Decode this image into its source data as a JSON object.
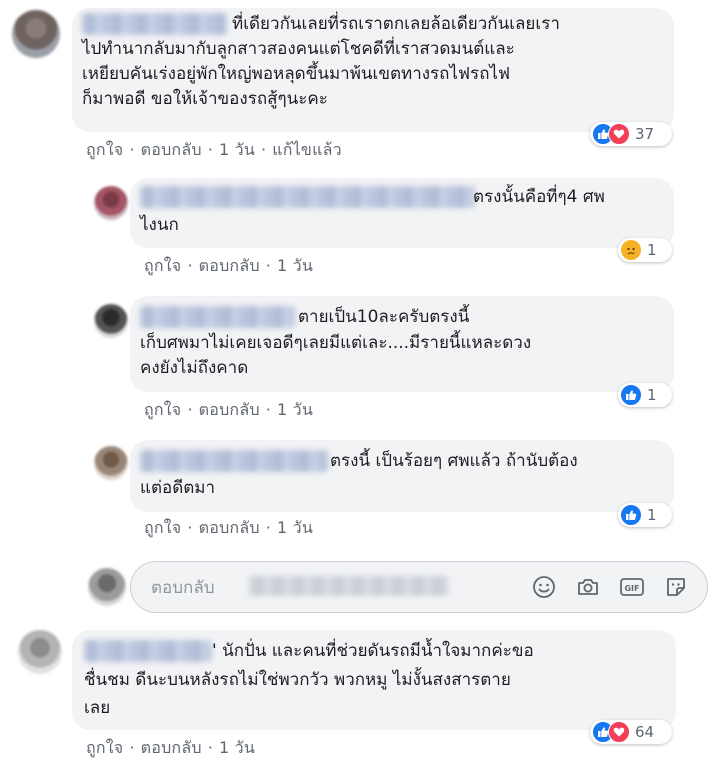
{
  "comments": [
    {
      "lines": [
        "ที่เดียวกันเลยที่รถเราตกเลยล้อเดียวกันเลยเรา",
        "ไปทำนากลับมากับลูกสาวสองคนแต่โชคดีที่เราสวดมนต์และ",
        "เหยียบคันเร่งอยู่พักใหญ่พอหลุดขึ้นมาพ้นเขตทางรถไฟรถไฟ",
        "ก็มาพอดี ขอให้เจ้าของรถสู้ๆนะคะ"
      ],
      "actions": [
        "ถูกใจ",
        "ตอบกลับ",
        "1 วัน",
        "แก้ไขแล้ว"
      ],
      "reaction_count": "37",
      "reaction_icons": [
        "like-icon",
        "love-icon"
      ]
    },
    {
      "lines": [
        "ตรงนั้นคือที่ๆ4 ศพ",
        "ไงนก"
      ],
      "actions": [
        "ถูกใจ",
        "ตอบกลับ",
        "1 วัน"
      ],
      "reaction_count": "1",
      "reaction_icons": [
        "sad-icon"
      ]
    },
    {
      "lines": [
        "ตายเป็น10ละครับตรงนี้",
        "เก็บศพมาไม่เคยเจอดีๆเลยมีแต่เละ....มีรายนี้แหละดวง",
        "คงยังไม่ถึงคาด"
      ],
      "actions": [
        "ถูกใจ",
        "ตอบกลับ",
        "1 วัน"
      ],
      "reaction_count": "1",
      "reaction_icons": [
        "like-icon"
      ]
    },
    {
      "lines": [
        "ตรงนี้ เป็นร้อยๆ ศพแล้ว ถ้านับต้อง",
        "แต่อดีตมา"
      ],
      "actions": [
        "ถูกใจ",
        "ตอบกลับ",
        "1 วัน"
      ],
      "reaction_count": "1",
      "reaction_icons": [
        "like-icon"
      ]
    },
    {
      "lines": [
        "' นักปั่น และคนที่ช่วยดันรถมีน้ำใจมากค่ะขอ",
        "ชื่นชม ดีนะบนหลังรถไม่ใช่พวกวัว พวกหมู ไม่งั้นสงสารตาย",
        "เลย"
      ],
      "actions": [
        "ถูกใจ",
        "ตอบกลับ",
        "1 วัน"
      ],
      "reaction_count": "64",
      "reaction_icons": [
        "like-icon",
        "love-icon"
      ]
    }
  ],
  "reply_box": {
    "placeholder": "ตอบกลับ",
    "icons": [
      "emoji-icon",
      "camera-icon",
      "gif-icon",
      "sticker-icon"
    ],
    "gif_label": "GIF"
  },
  "colors": {
    "bubble_bg": "#f2f3f5",
    "action_text": "#606770",
    "like_blue": "#1877f2",
    "love_red": "#f33e58",
    "sad_yellow": "#f7b125"
  }
}
